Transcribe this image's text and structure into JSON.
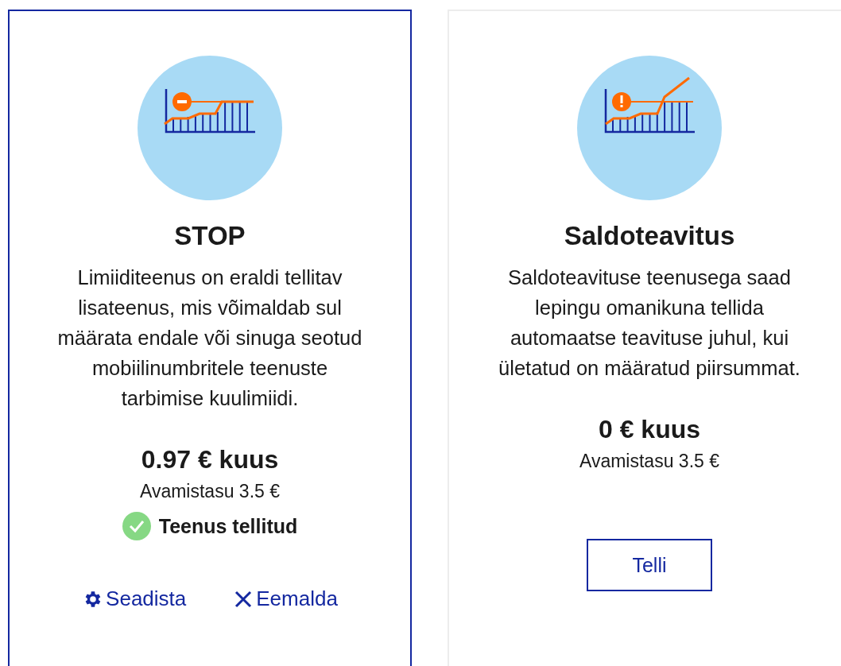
{
  "cards": [
    {
      "selected": true,
      "kind": "minus",
      "title": "STOP",
      "description": "Limiiditeenus on eraldi tellitav lisateenus, mis võimaldab sul määrata endale või sinuga seotud mobiilinumbritele teenuste tarbimise kuulimiidi.",
      "price": "0.97 € kuus",
      "fee": "Avamistasu 3.5 €",
      "subscribed": true,
      "status": "Teenus tellitud",
      "actions": [
        {
          "kind": "settings",
          "label": "Seadista"
        },
        {
          "kind": "remove",
          "label": "Eemalda"
        }
      ]
    },
    {
      "selected": false,
      "kind": "alert",
      "title": "Saldoteavitus",
      "description": "Saldoteavituse teenusega saad lepingu omanikuna tellida automaatse teavituse juhul, kui ületatud on määratud piirsummat.",
      "price": "0 € kuus",
      "fee": "Avamistasu 3.5 €",
      "subscribed": false,
      "button": "Telli"
    }
  ]
}
